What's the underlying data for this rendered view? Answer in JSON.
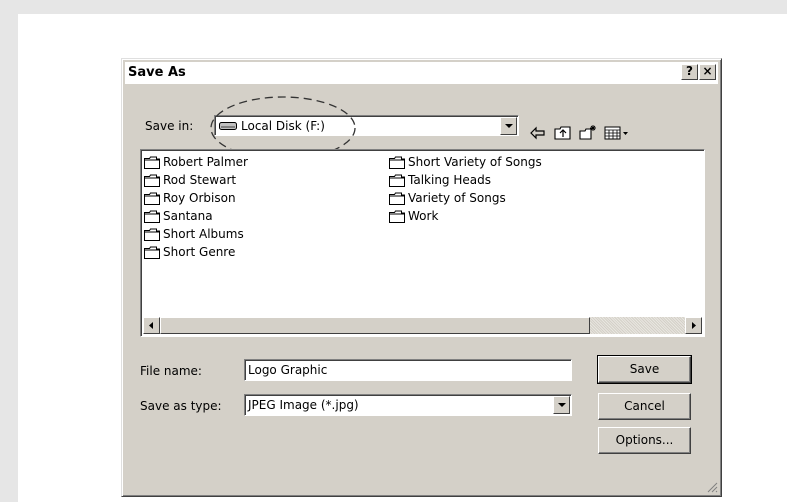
{
  "dialog": {
    "title": "Save As",
    "help_label": "?",
    "close_label": "×"
  },
  "save_in": {
    "label": "Save in:",
    "value": "Local Disk (F:)"
  },
  "toolbar": {
    "back_icon": "back-arrow-icon",
    "up_icon": "up-folder-icon",
    "new_folder_icon": "new-folder-icon",
    "view_icon": "view-menu-icon"
  },
  "folders_col1": [
    "Robert Palmer",
    "Rod Stewart",
    "Roy Orbison",
    "Santana",
    "Short Albums",
    "Short Genre"
  ],
  "folders_col2": [
    "Short Variety of Songs",
    "Talking Heads",
    "Variety of Songs",
    "Work"
  ],
  "file_name": {
    "label": "File name:",
    "value": "Logo Graphic"
  },
  "save_type": {
    "label": "Save as type:",
    "value": "JPEG Image (*.jpg)"
  },
  "buttons": {
    "save": "Save",
    "cancel": "Cancel",
    "options": "Options..."
  }
}
